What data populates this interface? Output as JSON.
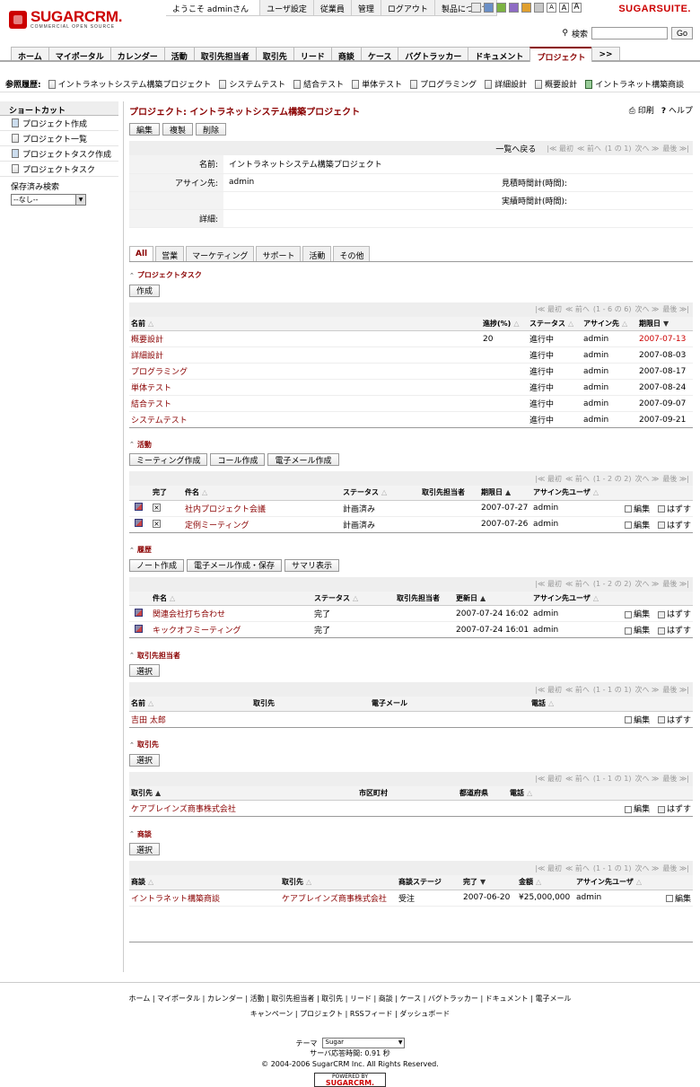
{
  "brand": {
    "logo": "SUGARCRM.",
    "logo_sub": "COMMERCIAL OPEN SOURCE",
    "suite": "SUGARSUITE."
  },
  "topnav": [
    "ようこそ adminさん",
    "ユーザ設定",
    "従業員",
    "管理",
    "ログアウト",
    "製品について"
  ],
  "theme_colors": [
    "#e8e8e8",
    "#6a8fc7",
    "#7cb342",
    "#8e6cc4",
    "#e0a030",
    "#c8c8c8"
  ],
  "font_sizes": [
    "A",
    "A",
    "A"
  ],
  "search": {
    "label": "検索",
    "button": "Go"
  },
  "tabs": [
    "ホーム",
    "マイポータル",
    "カレンダー",
    "活動",
    "取引先担当者",
    "取引先",
    "リード",
    "商談",
    "ケース",
    "バグトラッカー",
    "ドキュメント",
    "プロジェクト",
    ">>"
  ],
  "last_viewed": {
    "label": "参照履歴:",
    "items": [
      "イントラネットシステム構築プロジェクト",
      "システムテスト",
      "結合テスト",
      "単体テスト",
      "プログラミング",
      "詳細設計",
      "概要設計",
      "イントラネット構築商談"
    ]
  },
  "sidebar": {
    "title": "ショートカット",
    "items": [
      "プロジェクト作成",
      "プロジェクト一覧",
      "プロジェクトタスク作成",
      "プロジェクトタスク"
    ],
    "saved_label": "保存済み検索",
    "saved_value": "--なし--"
  },
  "page": {
    "title": "プロジェクト: イントラネットシステム構築プロジェクト",
    "print": "印刷",
    "help": "ヘルプ"
  },
  "buttons": {
    "edit": "編集",
    "copy": "複製",
    "delete": "削除"
  },
  "nav": {
    "back": "一覧へ戻る",
    "first": "最初",
    "prev": "前へ",
    "count": "(1 の 1)",
    "next": "次へ",
    "last": "最後"
  },
  "detail": {
    "name_label": "名前:",
    "name_value": "イントラネットシステム構築プロジェクト",
    "assigned_label": "アサイン先:",
    "assigned_value": "admin",
    "est_label": "見積時間計(時間):",
    "act_label": "実績時間計(時間):",
    "desc_label": "詳細:"
  },
  "subtabs": [
    "All",
    "営業",
    "マーケティング",
    "サポート",
    "活動",
    "その他"
  ],
  "tasks": {
    "title": "プロジェクトタスク",
    "create": "作成",
    "count": "(1 - 6 の 6)",
    "headers": [
      "名前",
      "進捗(%)",
      "ステータス",
      "アサイン先",
      "期限日"
    ],
    "rows": [
      [
        "概要設計",
        "20",
        "進行中",
        "admin",
        "2007-07-13"
      ],
      [
        "詳細設計",
        "",
        "進行中",
        "admin",
        "2007-08-03"
      ],
      [
        "プログラミング",
        "",
        "進行中",
        "admin",
        "2007-08-17"
      ],
      [
        "単体テスト",
        "",
        "進行中",
        "admin",
        "2007-08-24"
      ],
      [
        "結合テスト",
        "",
        "進行中",
        "admin",
        "2007-09-07"
      ],
      [
        "システムテスト",
        "",
        "進行中",
        "admin",
        "2007-09-21"
      ]
    ]
  },
  "activities": {
    "title": "活動",
    "buttons": [
      "ミーティング作成",
      "コール作成",
      "電子メール作成"
    ],
    "count": "(1 - 2 の 2)",
    "headers": [
      "完了",
      "件名",
      "ステータス",
      "取引先担当者",
      "期限日",
      "アサイン先ユーザ"
    ],
    "rows": [
      [
        "社内プロジェクト会議",
        "計画済み",
        "",
        "2007-07-27",
        "admin"
      ],
      [
        "定例ミーティング",
        "計画済み",
        "",
        "2007-07-26",
        "admin"
      ]
    ],
    "edit": "編集",
    "remove": "はずす"
  },
  "history": {
    "title": "履歴",
    "buttons": [
      "ノート作成",
      "電子メール作成・保存",
      "サマリ表示"
    ],
    "count": "(1 - 2 の 2)",
    "headers": [
      "件名",
      "ステータス",
      "取引先担当者",
      "更新日",
      "アサイン先ユーザ"
    ],
    "rows": [
      [
        "関連会社打ち合わせ",
        "完了",
        "",
        "2007-07-24 16:02",
        "admin"
      ],
      [
        "キックオフミーティング",
        "完了",
        "",
        "2007-07-24 16:01",
        "admin"
      ]
    ]
  },
  "contacts": {
    "title": "取引先担当者",
    "select": "選択",
    "count": "(1 - 1 の 1)",
    "headers": [
      "名前",
      "取引先",
      "電子メール",
      "電話"
    ],
    "rows": [
      [
        "吉田 太郎",
        "",
        "",
        ""
      ]
    ]
  },
  "accounts": {
    "title": "取引先",
    "select": "選択",
    "count": "(1 - 1 の 1)",
    "headers": [
      "取引先",
      "市区町村",
      "都道府県",
      "電話"
    ],
    "rows": [
      [
        "ケアブレインズ商事株式会社",
        "",
        "",
        ""
      ]
    ]
  },
  "opps": {
    "title": "商談",
    "select": "選択",
    "count": "(1 - 1 の 1)",
    "headers": [
      "商談",
      "取引先",
      "商談ステージ",
      "完了",
      "金額",
      "アサイン先ユーザ"
    ],
    "rows": [
      [
        "イントラネット構築商談",
        "ケアブレインズ商事株式会社",
        "受注",
        "2007-06-20",
        "¥25,000,000",
        "admin"
      ]
    ]
  },
  "footer": {
    "links1": "ホーム | マイポータル | カレンダー | 活動 | 取引先担当者 | 取引先 | リード | 商談 | ケース | バグトラッカー | ドキュメント | 電子メール",
    "links2": "キャンペーン | プロジェクト | RSSフィード | ダッシュボード",
    "theme_label": "テーマ",
    "theme_value": "Sugar",
    "response": "サーバ応答時間: 0.91 秒",
    "copyright": "© 2004-2006 SugarCRM Inc. All Rights Reserved.",
    "powered": "POWERED BY",
    "powered_brand": "SUGARCRM."
  }
}
